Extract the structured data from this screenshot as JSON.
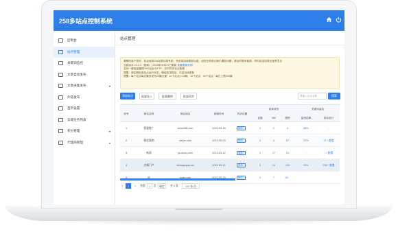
{
  "app": {
    "title": "258多站点控制系统"
  },
  "sidebar": {
    "items": [
      {
        "label": "控制台",
        "caret": ""
      },
      {
        "label": "站点管理",
        "caret": ""
      },
      {
        "label": "关键词监控",
        "caret": ""
      },
      {
        "label": "文章自动发布",
        "caret": ""
      },
      {
        "label": "文章采集发布",
        "caret": "▾"
      },
      {
        "label": "外链发布",
        "caret": ""
      },
      {
        "label": "首页设置",
        "caret": ""
      },
      {
        "label": "云端任务列表",
        "caret": ""
      },
      {
        "label": "积分管理",
        "caret": "▾"
      },
      {
        "label": "代理商管理",
        "caret": "▾"
      }
    ]
  },
  "main": {
    "page_title": "站点管理",
    "notice": [
      "尊敬的客户您好，欢迎使用258站群控制系统，系统将持续更新功能，如您在使用过程中遇到问题，请及时联系客服，同时欢迎您提出宝贵意见",
      "当前版本 v3.1.0（更新）| 2020年05月21日更新",
      "支持一键批量管理CMS后台与FTP，实时同步站点数据",
      "提醒：请定期检查站点运行状态，确保收录稳定、内容持续更新",
      "提醒：每个站点每日最多发布20篇文章 · 10个站点(=10篇) · 10个站点 · 30个站点 · 每日上限200篇"
    ],
    "notice_link": "查看更新说明",
    "buttons": [
      "添加站点",
      "批量导入",
      "批量删除",
      "批量同步"
    ],
    "search_placeholder": "请输入站点名称",
    "search_label": "搜索"
  },
  "table": {
    "header_top": [
      "序号",
      "网站名称",
      "绑定域名",
      "到期时间",
      "同步设置",
      "收录状态",
      "关键词监控"
    ],
    "header_sub": [
      "百度",
      "360",
      "搜狗",
      "监测结果",
      "排名统计"
    ],
    "rows": [
      {
        "num": "1",
        "name": "我要推广",
        "domain": "sohu168.com",
        "date": "2021-05-15",
        "op": "修改 ▪",
        "baidu": "0",
        "s360": "0",
        "sogou": "4",
        "pct": "88%",
        "rank": "-"
      },
      {
        "num": "2",
        "name": "微信营销",
        "domain": "nakjm.com",
        "date": "2021-05-03",
        "op": "修改 ▪",
        "baidu": "0",
        "s360": "3",
        "sogou": "57",
        "pct": "22%",
        "rank": "27 / 查看"
      },
      {
        "num": "3",
        "name": "新闻",
        "domain": "ys-docq.com",
        "date": "2021-03-12",
        "op": "修改 ▪",
        "baidu": "1",
        "s360": "17",
        "sogou": "51",
        "pct": "-",
        "rank": "- / 查看"
      },
      {
        "num": "4",
        "name": "点睛门户",
        "domain": "chinaqinpai.net",
        "date": "2021-05-12",
        "op": "修改 ▪",
        "baidu": "5",
        "s360": "19",
        "sogou": "103",
        "pct": "20%",
        "rank": "298 / 查看"
      },
      {
        "num": "5",
        "name": "站",
        "domain": "tuhet.com",
        "date": "2021-05-24",
        "op": "修改 ▪",
        "baidu": "0",
        "s360": "7",
        "sogou": "18...",
        "pct": "",
        "rank": ""
      }
    ]
  },
  "pager": {
    "prev": "<",
    "pages": [
      "1"
    ],
    "next": ">",
    "goto_label": "到第",
    "goto_value": "1",
    "page_unit": "页",
    "confirm": "确定",
    "total": "共 5 条",
    "page_size": "100 条/页"
  },
  "colors": {
    "accent": "#2d7ee8",
    "notice_bg": "#fdf7e2"
  },
  "icons": {
    "home": "home-icon",
    "power": "power-icon"
  }
}
